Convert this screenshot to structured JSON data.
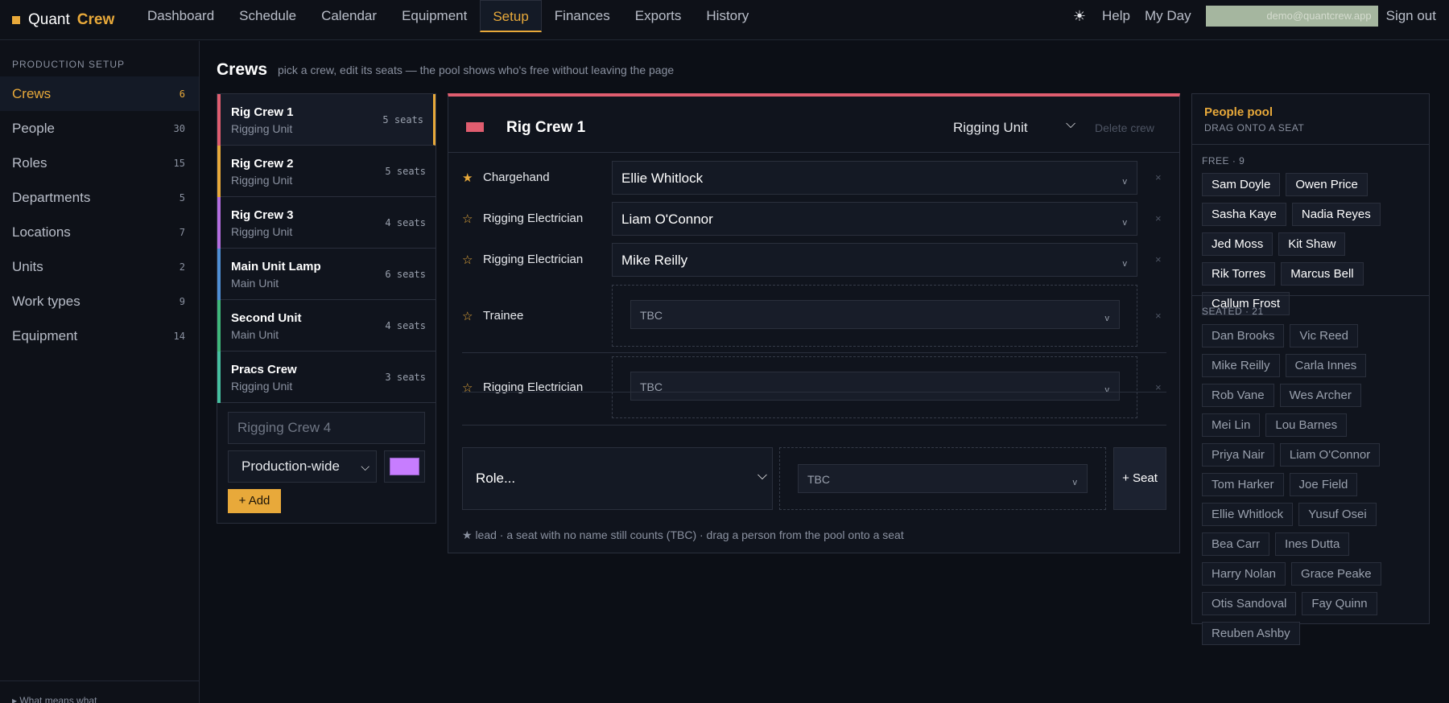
{
  "brand": {
    "name": "Quant",
    "accent": "Crew"
  },
  "nav": [
    "Dashboard",
    "Schedule",
    "Calendar",
    "Equipment",
    "Setup",
    "Finances",
    "Exports",
    "History"
  ],
  "nav_active": "Setup",
  "topright": {
    "theme_icon": "sun-icon",
    "help": "Help",
    "myday": "My Day",
    "email": "demo@quantcrew.app",
    "signout": "Sign out"
  },
  "sidebar": {
    "heading": "PRODUCTION SETUP",
    "items": [
      {
        "label": "Crews",
        "count": "6"
      },
      {
        "label": "People",
        "count": "30"
      },
      {
        "label": "Roles",
        "count": "15"
      },
      {
        "label": "Departments",
        "count": "5"
      },
      {
        "label": "Locations",
        "count": "7"
      },
      {
        "label": "Units",
        "count": "2"
      },
      {
        "label": "Work types",
        "count": "9"
      },
      {
        "label": "Equipment",
        "count": "14"
      }
    ],
    "footer": "▸ What means what"
  },
  "page": {
    "title": "Crews",
    "subtitle": "pick a crew, edit its seats — the pool shows who's free without leaving the page"
  },
  "crews": [
    {
      "name": "Rig Crew 1",
      "unit": "Rigging Unit",
      "seats": "5 seats",
      "color": "#e05d6f"
    },
    {
      "name": "Rig Crew 2",
      "unit": "Rigging Unit",
      "seats": "5 seats",
      "color": "#e8a93a"
    },
    {
      "name": "Rig Crew 3",
      "unit": "Rigging Unit",
      "seats": "4 seats",
      "color": "#b46ee0"
    },
    {
      "name": "Main Unit Lamp",
      "unit": "Main Unit",
      "seats": "6 seats",
      "color": "#4f8fd6"
    },
    {
      "name": "Second Unit",
      "unit": "Main Unit",
      "seats": "4 seats",
      "color": "#3fb87a"
    },
    {
      "name": "Pracs Crew",
      "unit": "Rigging Unit",
      "seats": "3 seats",
      "color": "#46c0a0"
    }
  ],
  "new_crew": {
    "placeholder": "Rigging Crew 4",
    "unit": "Production-wide",
    "color": "#c77dff",
    "add": "+ Add"
  },
  "editor": {
    "name": "Rig Crew 1",
    "color": "#e05d6f",
    "unit": "Rigging Unit",
    "delete": "Delete crew",
    "seats": [
      {
        "star": "★",
        "role": "Chargehand",
        "person": "Ellie Whitlock"
      },
      {
        "star": "☆",
        "role": "Rigging Electrician",
        "person": "Liam O'Connor"
      },
      {
        "star": "☆",
        "role": "Rigging Electrician",
        "person": "Mike Reilly"
      },
      {
        "star": "☆",
        "role": "Trainee",
        "person": "TBC"
      },
      {
        "star": "☆",
        "role": "Rigging Electrician",
        "person": "TBC"
      }
    ],
    "remove": "×",
    "caret": "v",
    "add_role": "Role...",
    "add_person": "TBC",
    "add_seat": "+ Seat",
    "legend": "★ lead · a seat with no name still counts (TBC) · drag a person from the pool onto a seat"
  },
  "pool": {
    "title": "People pool",
    "hint": "DRAG ONTO A SEAT",
    "free_label": "FREE · 9",
    "free": [
      "Sam Doyle",
      "Owen Price",
      "Sasha Kaye",
      "Nadia Reyes",
      "Jed Moss",
      "Kit Shaw",
      "Rik Torres",
      "Marcus Bell",
      "Callum Frost"
    ],
    "seated_label": "SEATED · 21",
    "seated": [
      "Dan Brooks",
      "Vic Reed",
      "Mike Reilly",
      "Carla Innes",
      "Rob Vane",
      "Wes Archer",
      "Mei Lin",
      "Lou Barnes",
      "Priya Nair",
      "Liam O'Connor",
      "Tom Harker",
      "Joe Field",
      "Ellie Whitlock",
      "Yusuf Osei",
      "Bea Carr",
      "Ines Dutta",
      "Harry Nolan",
      "Grace Peake",
      "Otis Sandoval",
      "Fay Quinn",
      "Reuben Ashby"
    ]
  }
}
